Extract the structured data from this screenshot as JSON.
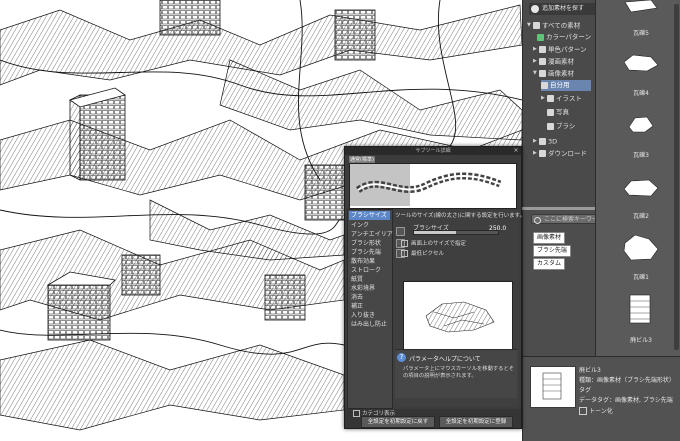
{
  "material_tree": {
    "top_button": "追加素材を探す",
    "items": [
      {
        "label": "すべての素材",
        "icon": "folder-icon",
        "expanded": true
      },
      {
        "label": "カラーパターン",
        "icon": "color-pattern-icon"
      },
      {
        "label": "単色パターン",
        "icon": "mono-pattern-icon"
      },
      {
        "label": "漫画素材",
        "icon": "manga-material-icon"
      },
      {
        "label": "画像素材",
        "icon": "image-material-icon",
        "expanded": true
      },
      {
        "label": "自分用",
        "icon": "folder-icon",
        "selected": true
      },
      {
        "label": "イラスト",
        "icon": "illustration-icon"
      },
      {
        "label": "写真",
        "icon": "photo-icon"
      },
      {
        "label": "ブラシ",
        "icon": "brush-icon"
      },
      {
        "label": "3D",
        "icon": "3d-icon"
      },
      {
        "label": "ダウンロード",
        "icon": "download-icon"
      }
    ]
  },
  "tag_panel": {
    "search_placeholder": "ここに検索キーワード",
    "tags": [
      "画像素材",
      "ブラシ先端",
      "カスタム"
    ]
  },
  "thumbnails": [
    {
      "label": "瓦礫5"
    },
    {
      "label": "瓦礫4"
    },
    {
      "label": "瓦礫3"
    },
    {
      "label": "瓦礫2"
    },
    {
      "label": "瓦礫1"
    },
    {
      "label": "廃ビル3"
    }
  ],
  "info_panel": {
    "name": "廃ビル3",
    "kind": "種類：画像素材（ブラシ先端形状）",
    "count": "タグ",
    "tags": "データタグ：画像素材, ブラシ先端",
    "toon_label": "トーン化"
  },
  "brush_dialog": {
    "title": "サブツール詳細",
    "tab_label": "通常(標準)",
    "categories": [
      "ブラシサイズ",
      "インク",
      "アンチエイリアス",
      "ブラシ形状",
      "ブラシ先端",
      "散布効果",
      "ストローク",
      "紙質",
      "水彩境界",
      "消去",
      "補正",
      "入り抜き",
      "はみ出し防止"
    ],
    "selected_category": "ブラシサイズ",
    "description": "ツールのサイズ(線の太さ)に関する設定を行います。",
    "brush_size_label": "ブラシサイズ",
    "brush_size_value": "250.0",
    "brush_size_fraction": 0.5,
    "option_1": "画面上のサイズで指定",
    "option_2": "最低ピクセル",
    "help_title": "パラメータヘルプについて",
    "help_text": "パラメータ上にマウスカーソルを移動するとその項目の説明が表示されます。",
    "show_category_label": "カテゴリ表示",
    "reset_button": "全設定を初期設定に戻す",
    "register_button": "全設定を初期設定に登録"
  }
}
